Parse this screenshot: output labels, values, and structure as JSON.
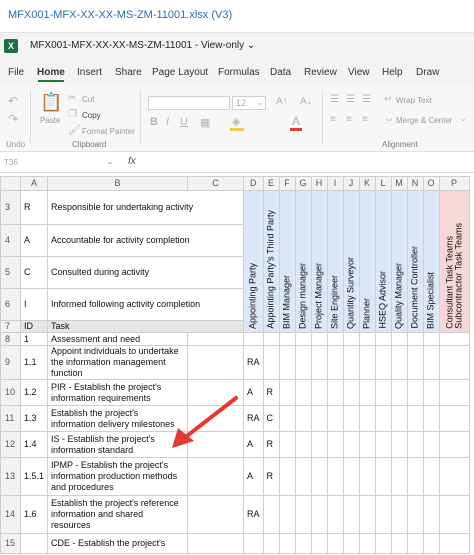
{
  "window": {
    "doc_title": "MFX001-MFX-XX-XX-MS-ZM-11001.xlsx (V3)",
    "file_title": "MFX001-MFX-XX-XX-MS-ZM-11001  -  View-only",
    "file_title_caret": "⌄",
    "logo": "X"
  },
  "menu": {
    "items": [
      "File",
      "Home",
      "Insert",
      "Share",
      "Page Layout",
      "Formulas",
      "Data",
      "Review",
      "View",
      "Help",
      "Draw"
    ],
    "active": "Home"
  },
  "ribbon": {
    "undo_label": "Undo",
    "paste_label": "Paste",
    "cut_label": "Cut",
    "copy_label": "Copy",
    "format_painter_label": "Format Painter",
    "clipboard_group": "Clipboard",
    "font_size": "12",
    "wrap_text_label": "Wrap Text",
    "merge_center_label": "Merge & Center",
    "alignment_group": "Alignment",
    "bold": "B",
    "italic": "I",
    "underline": "U",
    "font_color": "A"
  },
  "formula_bar": {
    "name_box": "T36",
    "fx": "fx"
  },
  "sheet": {
    "column_headers": [
      "",
      "A",
      "B",
      "C",
      "D",
      "E",
      "F",
      "G",
      "H",
      "I",
      "J",
      "K",
      "L",
      "M",
      "N",
      "O",
      "P"
    ],
    "role_headers": [
      "Appointing Party",
      "Appointing Party's Third Party",
      "BIM Manager",
      "Design manager",
      "Project Manager",
      "Site Engineer",
      "Quantity Surveyor",
      "Planner",
      "HSEQ Advisor",
      "Quality Manager",
      "Document Controller",
      "BIM Specialist",
      "Consultant Task Teams",
      "Subcontractor Task Teams"
    ],
    "legend_rows": [
      {
        "row": "3",
        "code": "R",
        "text": "Responsible for undertaking activity"
      },
      {
        "row": "4",
        "code": "A",
        "text": "Accountable for activity completion"
      },
      {
        "row": "5",
        "code": "C",
        "text": "Consulted during activity"
      },
      {
        "row": "6",
        "code": "I",
        "text": "Informed following activity completion"
      }
    ],
    "header_row": {
      "row": "7",
      "id": "ID",
      "task": "Task"
    },
    "task_rows": [
      {
        "row": "8",
        "id": "1",
        "task": "Assessment and need",
        "d": "",
        "e": "",
        "f": ""
      },
      {
        "row": "9",
        "id": "1.1",
        "task": "Appoint individuals to undertake the information management function",
        "d": "RA",
        "e": "",
        "f": ""
      },
      {
        "row": "10",
        "id": "1.2",
        "task": "PIR - Establish the project's information requirements",
        "d": "A",
        "e": "R",
        "f": ""
      },
      {
        "row": "11",
        "id": "1.3",
        "task": "Establish the project's information delivery milestones",
        "d": "RA",
        "e": "C",
        "f": ""
      },
      {
        "row": "12",
        "id": "1.4",
        "task": "IS - Establish the project's information standard",
        "d": "A",
        "e": "R",
        "f": ""
      },
      {
        "row": "13",
        "id": "1.5.1",
        "task": "IPMP - Establish the project's information production methods and procedures",
        "d": "A",
        "e": "R",
        "f": ""
      },
      {
        "row": "14",
        "id": "1.6",
        "task": "Establish the project's reference information and shared resources",
        "d": "RA",
        "e": "",
        "f": ""
      },
      {
        "row": "15",
        "id": "",
        "task": "CDE - Establish the project's",
        "d": "",
        "e": "",
        "f": ""
      }
    ]
  },
  "colors": {
    "excel_green": "#217346",
    "role_blue": "#dce8f7",
    "role_pink": "#f6d7d7",
    "arrow_red": "#e53935",
    "title_blue": "#2b6cb0"
  }
}
